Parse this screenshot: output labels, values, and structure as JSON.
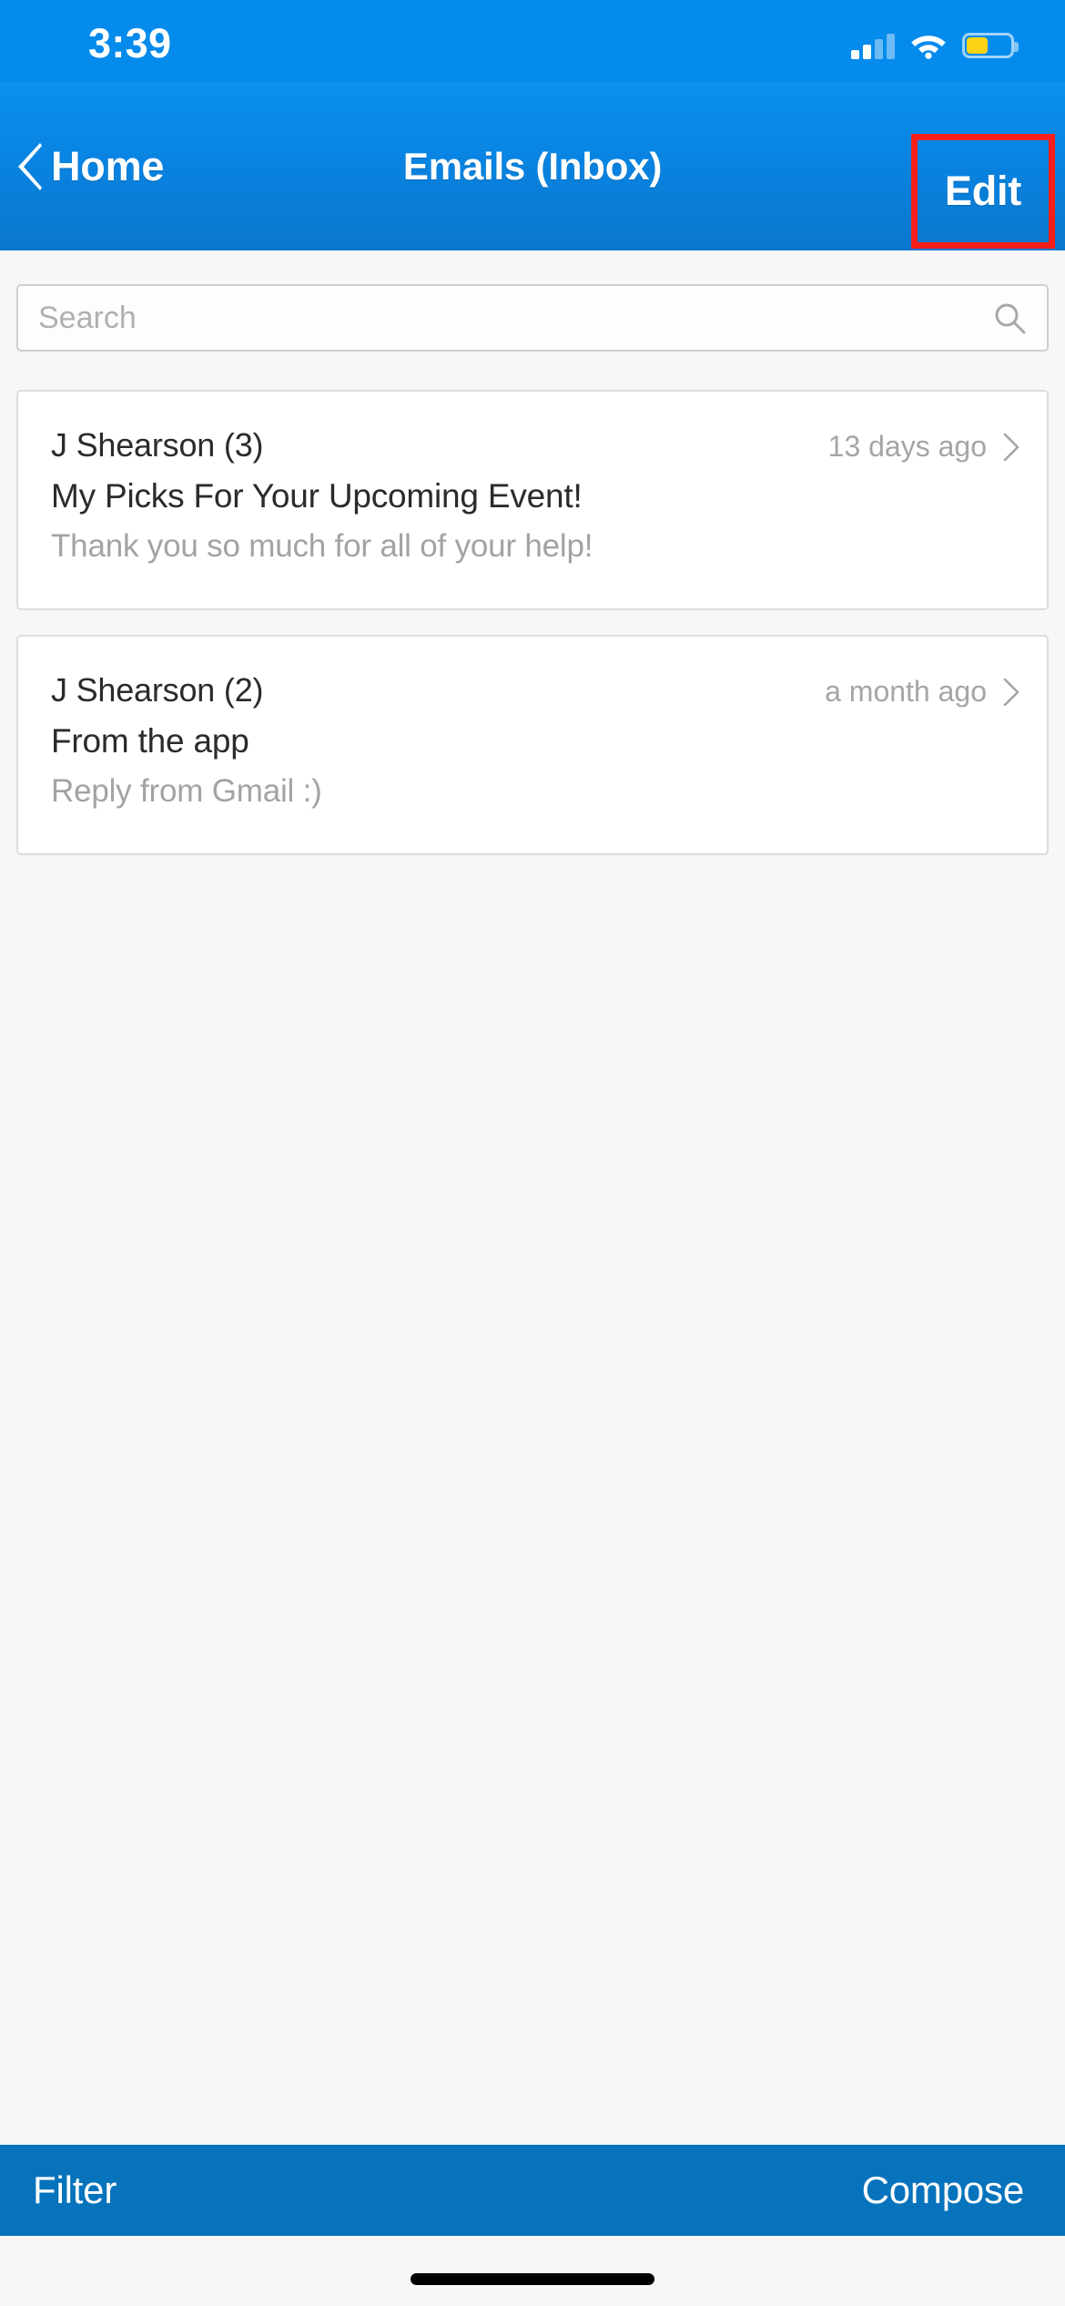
{
  "status_bar": {
    "time": "3:39",
    "cellular_icon": "cellular-signal-icon",
    "wifi_icon": "wifi-icon",
    "battery_icon": "battery-icon",
    "battery_fill_percent": 45,
    "battery_color": "#FCD316"
  },
  "nav_bar": {
    "back_label": "Home",
    "back_icon": "chevron-left-icon",
    "title": "Emails (Inbox)",
    "edit_label": "Edit",
    "highlight_color": "#F81E19",
    "background_color": "#0984E2"
  },
  "search": {
    "value": "",
    "placeholder": "Search",
    "icon": "search-icon"
  },
  "emails": [
    {
      "sender": "J Shearson (3)",
      "time": "13 days ago",
      "subject": "My Picks For Your Upcoming Event!",
      "preview": "Thank you so much for all of your help!",
      "chevron_icon": "chevron-right-icon"
    },
    {
      "sender": "J Shearson (2)",
      "time": "a month ago",
      "subject": "From the app",
      "preview": "Reply from Gmail :)",
      "chevron_icon": "chevron-right-icon"
    }
  ],
  "toolbar": {
    "filter_label": "Filter",
    "compose_label": "Compose",
    "background_color": "#0673BC"
  }
}
